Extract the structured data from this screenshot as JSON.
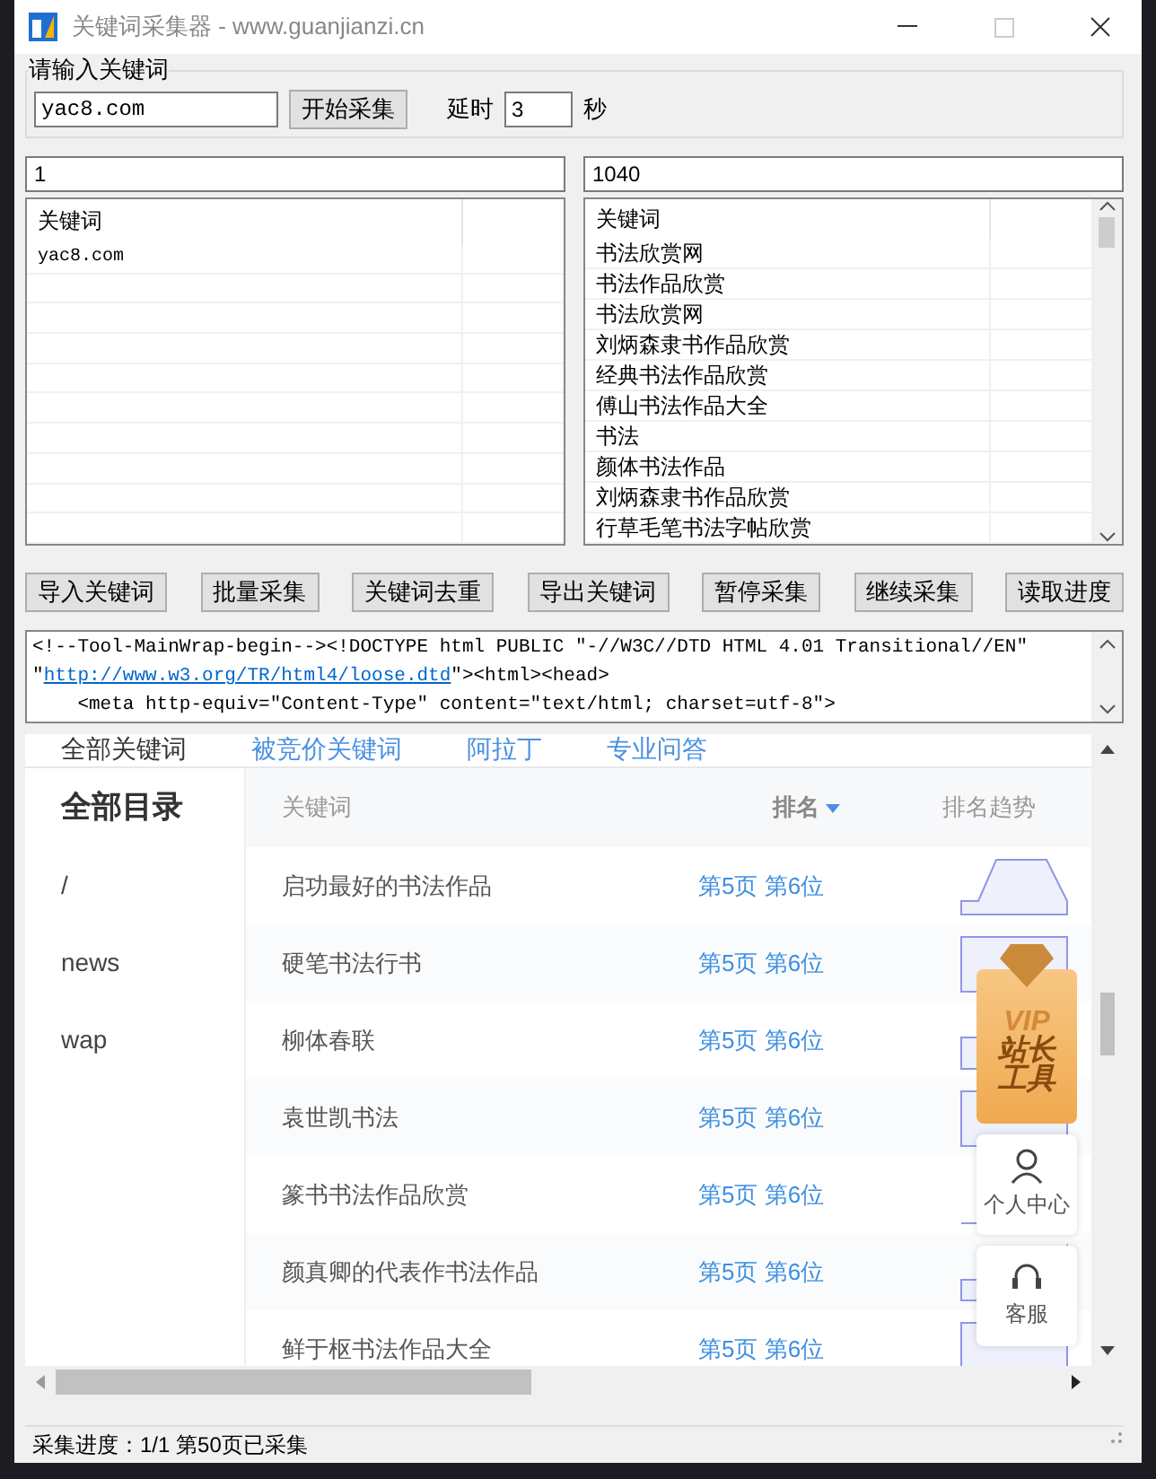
{
  "window": {
    "title": "关键词采集器 - www.guanjianzi.cn"
  },
  "keyword_group": {
    "label": "请输入关键词",
    "input_value": "yac8.com",
    "start_button": "开始采集",
    "delay_label": "延时",
    "delay_value": "3",
    "delay_unit": "秒"
  },
  "counters": [
    "1",
    "1040"
  ],
  "left_list": {
    "column": "关键词",
    "rows": [
      "yac8.com"
    ]
  },
  "right_list": {
    "column": "关键词",
    "rows": [
      "书法欣赏网",
      "书法作品欣赏",
      "书法欣赏网",
      "刘炳森隶书作品欣赏",
      "经典书法作品欣赏",
      "傅山书法作品大全",
      "书法",
      "颜体书法作品",
      "刘炳森隶书作品欣赏",
      "行草毛笔书法字帖欣赏"
    ]
  },
  "buttons": [
    "导入关键词",
    "批量采集",
    "关键词去重",
    "导出关键词",
    "暂停采集",
    "继续采集",
    "读取进度"
  ],
  "source_text": {
    "line_1": "<!--Tool-MainWrap-begin--><!DOCTYPE html PUBLIC \"-//W3C//DTD HTML 4.01 Transitional//EN\"",
    "line_2_before": "\"",
    "line_2_link": "http://www.w3.org/TR/html4/loose.dtd",
    "line_2_after": "\"><html><head>",
    "line_3": "    <meta http-equiv=\"Content-Type\" content=\"text/html; charset=utf-8\">"
  },
  "browser": {
    "tabs": [
      {
        "label": "全部关键词",
        "selected": true
      },
      {
        "label": "被竞价关键词",
        "selected": false
      },
      {
        "label": "阿拉丁",
        "selected": false
      },
      {
        "label": "专业问答",
        "selected": false
      }
    ],
    "sidebar": {
      "title": "全部目录",
      "items": [
        "/",
        "news",
        "wap"
      ]
    },
    "table": {
      "columns": [
        "关键词",
        "排名",
        "排名趋势"
      ],
      "rows": [
        {
          "keyword": "启功最好的书法作品",
          "rank": "第5页 第6位"
        },
        {
          "keyword": "硬笔书法行书",
          "rank": "第5页 第6位"
        },
        {
          "keyword": "柳体春联",
          "rank": "第5页 第6位"
        },
        {
          "keyword": "袁世凯书法",
          "rank": "第5页 第6位"
        },
        {
          "keyword": "篆书书法作品欣赏",
          "rank": "第5页 第6位"
        },
        {
          "keyword": "颜真卿的代表作书法作品",
          "rank": "第5页 第6位"
        },
        {
          "keyword": "鲜于枢书法作品大全",
          "rank": "第5页 第6位"
        }
      ]
    },
    "widget": {
      "vip_line_1": "VIP",
      "vip_line_2": "站长",
      "vip_line_3": "工具",
      "profile": "个人中心",
      "service": "客服"
    }
  },
  "status_bar": "采集进度：1/1 第50页已采集"
}
